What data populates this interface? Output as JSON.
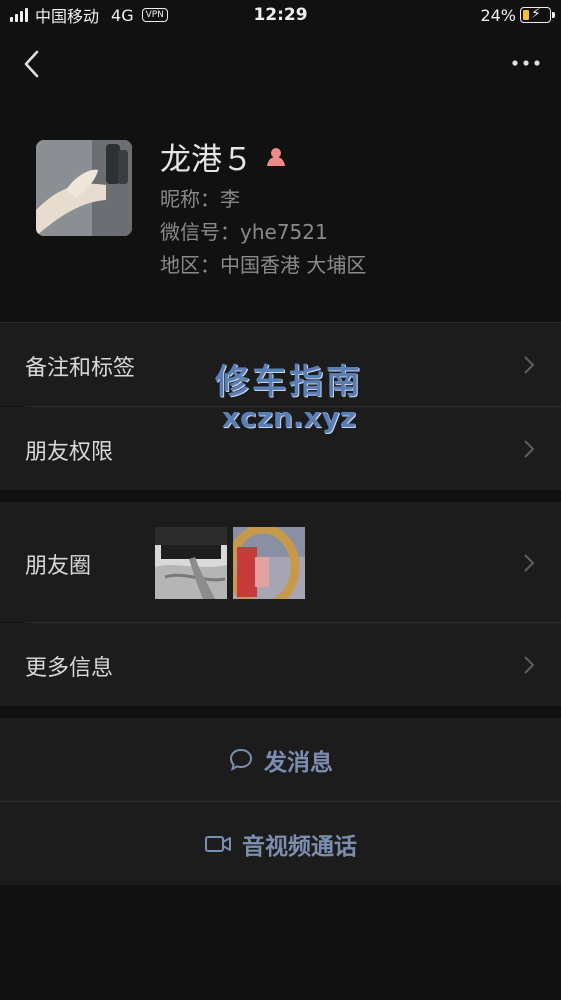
{
  "status_bar": {
    "carrier": "中国移动",
    "network": "4G",
    "vpn": "VPN",
    "time": "12:29",
    "battery": "24%",
    "battery_level": 0.24
  },
  "profile": {
    "name": "龙港５",
    "nickname": "昵称：李",
    "wechat_id": "微信号：yhe7521",
    "region": "地区：中国香港 大埔区",
    "gender_icon": "female-icon"
  },
  "cells": {
    "remark_tags": "备注和标签",
    "friend_permissions": "朋友权限",
    "moments": "朋友圈",
    "more_info": "更多信息"
  },
  "actions": {
    "send_message": "发消息",
    "video_call": "音视频通话"
  },
  "watermark": {
    "title": "修车指南",
    "url": "xczn.xyz"
  },
  "colors": {
    "background": "#111111",
    "cell": "#1c1c1c",
    "action_text": "#7c8eaf",
    "gender_icon": "#f08a8a",
    "battery_fill": "#f6c02d"
  }
}
